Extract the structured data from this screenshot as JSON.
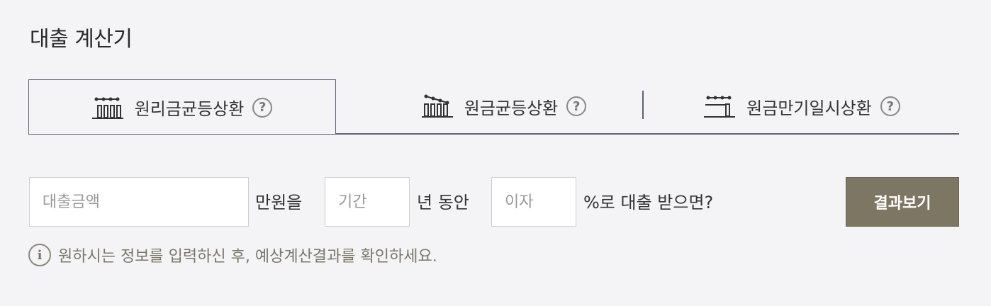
{
  "title": "대출 계산기",
  "tabs": [
    {
      "label": "원리금균등상환",
      "icon": "equal-principal-interest-chart-icon",
      "active": true
    },
    {
      "label": "원금균등상환",
      "icon": "equal-principal-chart-icon",
      "active": false
    },
    {
      "label": "원금만기일시상환",
      "icon": "lump-sum-maturity-chart-icon",
      "active": false
    }
  ],
  "help_symbol": "?",
  "form": {
    "amount_placeholder": "대출금액",
    "amount_unit": "만원을",
    "period_placeholder": "기간",
    "period_unit": "년 동안",
    "rate_placeholder": "이자",
    "rate_unit": "%로 대출 받으면?",
    "submit_label": "결과보기"
  },
  "note": {
    "icon": "info-icon",
    "icon_symbol": "i",
    "text": "원하시는 정보를 입력하신 후, 예상계산결과를 확인하세요."
  },
  "colors": {
    "background": "#f4f4f6",
    "tab_line": "#5d6274",
    "button": "#7c7663",
    "note_text": "#7a7766"
  }
}
